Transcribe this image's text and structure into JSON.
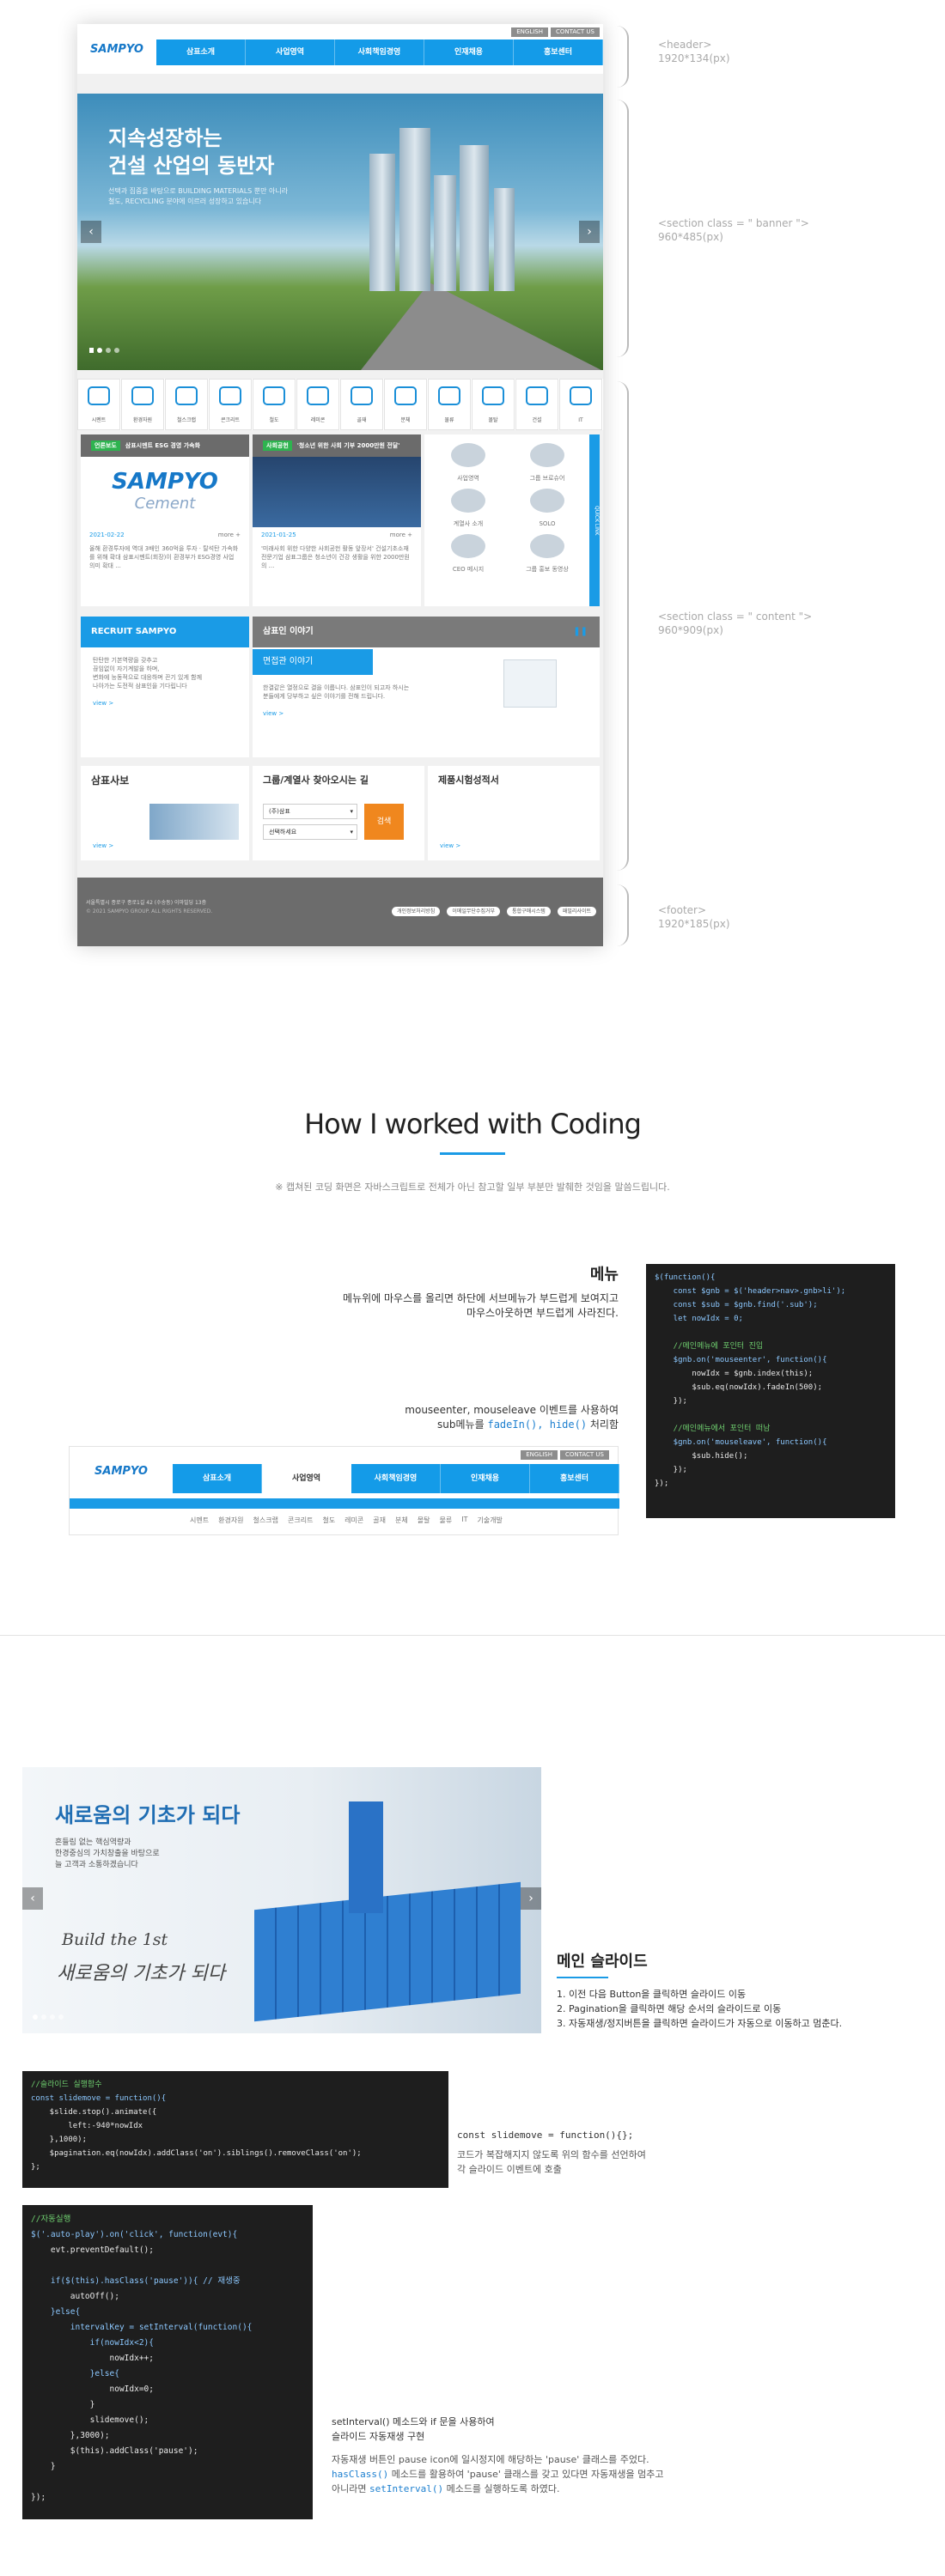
{
  "annotations": {
    "header": {
      "selector": "<header>",
      "size": "1920*134(px)"
    },
    "banner": {
      "selector": "<section class = \" banner \">",
      "size": "960*485(px)"
    },
    "content": {
      "selector": "<section class = \" content \">",
      "size": "960*909(px)"
    },
    "footer": {
      "selector": "<footer>",
      "size": "1920*185(px)"
    }
  },
  "site": {
    "logo": "SAMPYO",
    "util": [
      "ENGLISH",
      "CONTACT US"
    ],
    "gnb": [
      "삼표소개",
      "사업영역",
      "사회책임경영",
      "인재채용",
      "홍보센터"
    ],
    "banner_title_1": "지속성장하는",
    "banner_title_2": "건설 산업의 동반자",
    "banner_text_1": "선택과 집중을 바탕으로 BUILDING MATERIALS 뿐만 아니라",
    "banner_text_2": "철도, RECYCLING 분야에 이르러 성장하고 있습니다",
    "quick_icons": [
      "시멘트",
      "환경자원",
      "철스크랩",
      "콘크리트",
      "철도",
      "레미콘",
      "골재",
      "분체",
      "물류",
      "몰탈",
      "건설",
      "IT"
    ],
    "news1": {
      "head": "삼표시멘트 ESG 경영 가속화",
      "badge": "언론보도",
      "logo_1": "SAMPYO",
      "logo_2": "Cement",
      "date": "2021-02-22",
      "more": "more +",
      "text": "올해 환경투자에 역대 3배인 360억을 투자 · 탈석탄 가속화를 위해 확대 삼표시멘트(회장)이 환경부가 ESG경영 사업 의미 확대 ..."
    },
    "news2": {
      "head": "'청소년 위한 사회 기부 2000만원 전달'",
      "badge": "사회공헌",
      "date": "2021-01-25",
      "more": "more +",
      "text": "'미래사회 위한 다양한 사회공헌 활동 앞장서' 건설기초소재 전문기업 삼표그룹은 청소년이 건강 생활을 위한 2000만원의 ..."
    },
    "quick_menu": {
      "label": "QUICK LINK",
      "items": [
        "사업영역",
        "그룹 브로슈어",
        "계열사 소개",
        "SOLO",
        "CEO 메시지",
        "그룹 홍보 동영상"
      ]
    },
    "recruit": {
      "title": "RECRUIT SAMPYO",
      "text_1": "탄탄한 기본역량을 갖추고",
      "text_2": "끊임없이 자기계발을 하며,",
      "text_3": "변화에 능동적으로 대응하며 끈기 있게 함께",
      "text_4": "나아가는 도전적 삼표인을 기다립니다",
      "view": "view >"
    },
    "people": {
      "title": "삼표인 이야기",
      "sub": "면접관 이야기",
      "text_1": "한결같은 열정으로 결을 이룹니다. 삼표인이 되고자 하시는",
      "text_2": "분들에게 당부하고 싶은 이야기를 전해 드립니다.",
      "view": "view >"
    },
    "webzine": {
      "title": "삼표사보",
      "view": "view >"
    },
    "finder": {
      "title": "그룹/계열사 찾아오시는 길",
      "select1": "(주)삼표",
      "select2": "선택하세요",
      "button": "검색"
    },
    "test": {
      "title": "제품시험성적서",
      "view": "view >"
    },
    "footer": {
      "addr": "서울특별시 종로구 종로1길 42 (수송동) 이마빌딩 13층",
      "copy": "© 2021 SAMPYO GROUP. ALL RIGHTS RESERVED.",
      "links": [
        "개인정보처리방침",
        "이메일무단수집거부",
        "통합구매시스템",
        "패밀리사이트"
      ]
    }
  },
  "section_work": {
    "title": "How I worked with Coding",
    "note": "※ 캡쳐된 코딩 화면은 자바스크립트로 전체가 아닌 참고할 일부 부분만 발췌한 것임을 말씀드립니다."
  },
  "menu_block": {
    "title": "메뉴",
    "desc_1": "메뉴위에 마우스를 올리면 하단에 서브메뉴가 부드럽게 보여지고",
    "desc_2": "마우스아웃하면 부드럽게 사라진다.",
    "desc_3a": "mouseenter, mouseleave",
    "desc_3b": " 이벤트를 사용하여",
    "desc_4a": "sub메뉴를 ",
    "desc_4b": "fadeIn(), hide()",
    "desc_4c": " 처리함",
    "subnav": [
      "시멘트",
      "환경자원",
      "철스크랩",
      "콘크리트",
      "철도",
      "레미콘",
      "골재",
      "분체",
      "몰탈",
      "물류",
      "IT",
      "기술개발"
    ],
    "code": [
      "$(function(){",
      "    const $gnb = $('header>nav>.gnb>li');",
      "    const $sub = $gnb.find('.sub');",
      "    let nowIdx = 0;",
      "",
      "    //메인메뉴에 포인터 진입",
      "    $gnb.on('mouseenter', function(){",
      "        nowIdx = $gnb.index(this);",
      "        $sub.eq(nowIdx).fadeIn(500);",
      "    });",
      "",
      "    //메인메뉴에서 포인터 떠남",
      "    $gnb.on('mouseleave', function(){",
      "        $sub.hide();",
      "    });",
      "});"
    ]
  },
  "slide_block": {
    "banner_title": "새로움의 기초가 되다",
    "banner_text_1": "흔들림 없는 핵심역량과",
    "banner_text_2": "한경중심의 가치창출을 바탕으로",
    "banner_text_3": "늘 고객과 소통하겠습니다",
    "script_1": "Build the 1st",
    "script_2": "새로움의 기초가 되다",
    "title": "메인 슬라이드",
    "items": [
      "1. 이전 다음 Button을 클릭하면 슬라이드 이동",
      "2. Pagination을 클릭하면 해당 순서의 슬라이드로 이동",
      "3. 자동재생/정지버튼을 클릭하면 슬라이드가 자동으로 이동하고 멈춘다."
    ],
    "code1": [
      "//슬라이드 실행함수",
      "const slidemove = function(){",
      "    $slide.stop().animate({",
      "        left:-940*nowIdx",
      "    },1000);",
      "    $pagination.eq(nowIdx).addClass('on').siblings().removeClass('on');",
      "};"
    ],
    "code1_desc_1": "const slidemove = function(){};",
    "code1_desc_2": "코드가 복잡해지지 않도록 위의 함수를 선언하여",
    "code1_desc_3": "각 슬라이드 이벤트에 호출",
    "code2": [
      "//자동실행",
      "$('.auto-play').on('click', function(evt){",
      "    evt.preventDefault();",
      "",
      "    if($(this).hasClass('pause')){ // 재생중",
      "        autoOff();",
      "    }else{",
      "        intervalKey = setInterval(function(){",
      "            if(nowIdx<2){",
      "                nowIdx++;",
      "            }else{",
      "                nowIdx=0;",
      "            }",
      "            slidemove();",
      "        },3000);",
      "        $(this).addClass('pause');",
      "    }",
      "",
      "});"
    ],
    "code2_desc_1": "setInterval() 메소드와 if 문을 사용하여",
    "code2_desc_2": "슬라이드 자동재생 구현",
    "code2_desc_3": "자동재생 버튼인 pause icon에 일시정지에 해당하는 'pause' 클래스를 주었다.",
    "code2_desc_4a": "hasClass()",
    "code2_desc_4b": " 메소드를 활용하여 'pause' 클래스를 갖고 있다면 자동재생을 멈추고",
    "code2_desc_5a": "아니라면 ",
    "code2_desc_5b": "setInterval()",
    "code2_desc_5c": " 메소드를 실행하도록 하였다."
  }
}
